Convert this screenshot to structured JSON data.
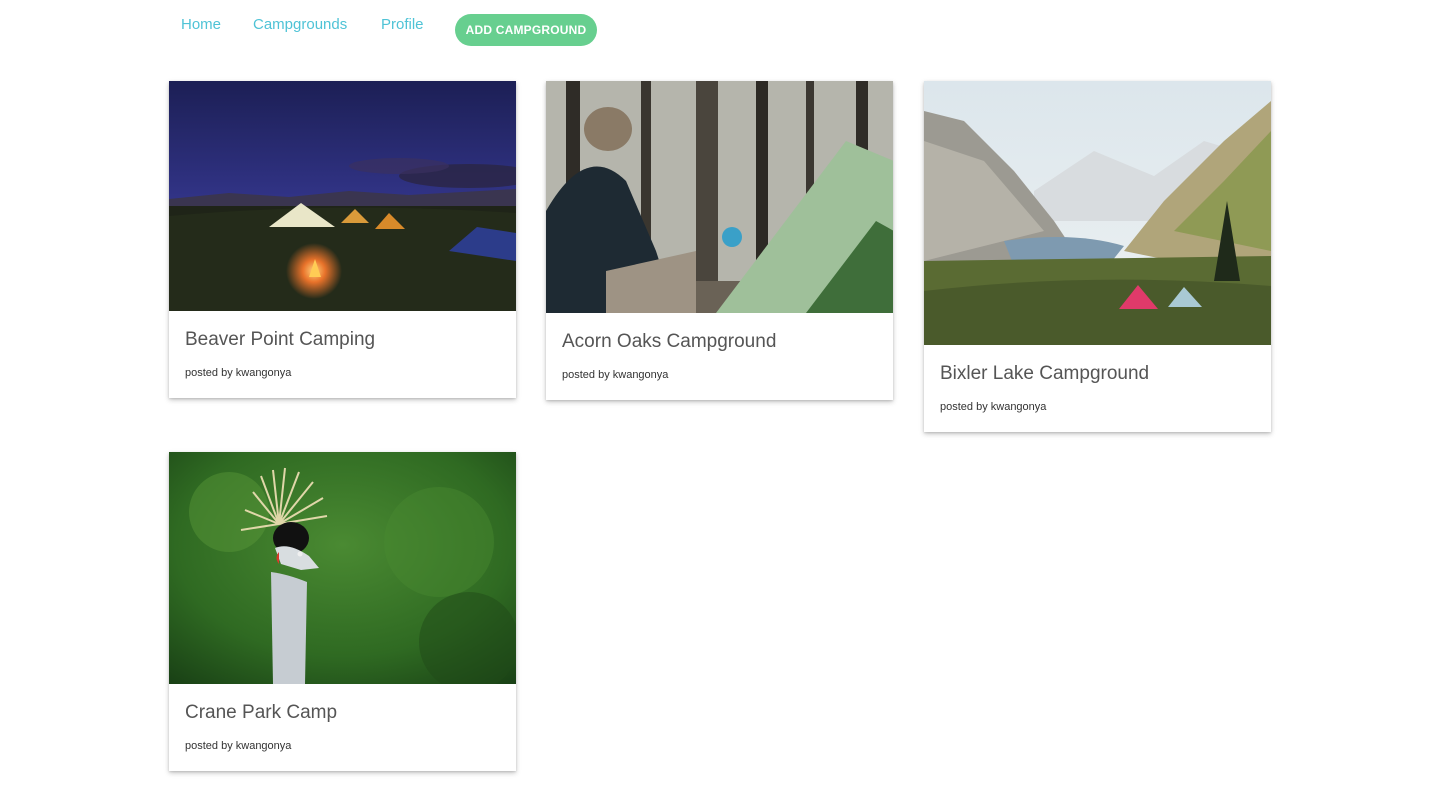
{
  "nav": {
    "links": [
      {
        "label": "Home"
      },
      {
        "label": "Campgrounds"
      },
      {
        "label": "Profile"
      }
    ],
    "add_button_label": "ADD CAMPGROUND",
    "accent_color": "#4fc3d6",
    "button_color": "#67cf8f"
  },
  "campgrounds": [
    {
      "title": "Beaver Point Camping",
      "posted_by": "posted by kwangonya",
      "image": "night-campfire-tents-photo"
    },
    {
      "title": "Acorn Oaks Campground",
      "posted_by": "posted by kwangonya",
      "image": "forest-camper-tent-photo"
    },
    {
      "title": "Bixler Lake Campground",
      "posted_by": "posted by kwangonya",
      "image": "mountain-lake-tents-photo"
    },
    {
      "title": "Crane Park Camp",
      "posted_by": "posted by kwangonya",
      "image": "crowned-crane-bird-photo"
    }
  ]
}
